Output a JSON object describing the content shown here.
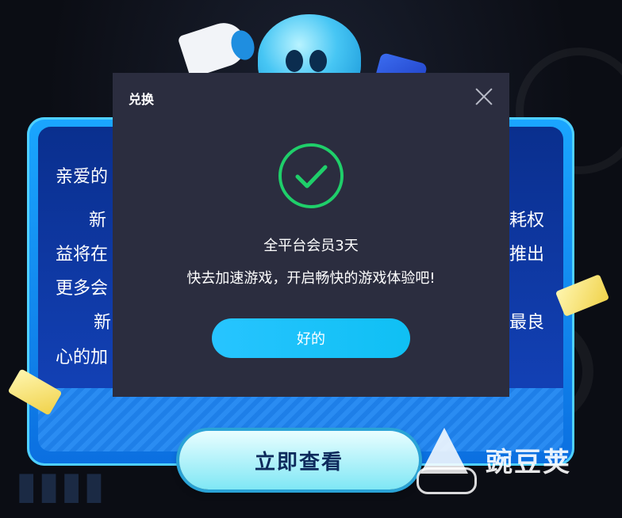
{
  "dialog": {
    "title": "兑换",
    "message_line1": "全平台会员3天",
    "message_line2": "快去加速游戏，开启畅快的游戏体验吧!",
    "ok_label": "好的",
    "close_icon": "close-icon",
    "success_icon": "check-circle-icon"
  },
  "background_card": {
    "line1": "亲爱的",
    "line2_left": "新",
    "line2_right": "耗权",
    "line3_left": "益将在",
    "line3_right": "推出",
    "line4_left": "更多会",
    "line5_left": "新",
    "line5_right": "最良",
    "line6_left": "心的加",
    "cta_label": "立即查看"
  },
  "watermark": {
    "text": "豌豆荚"
  },
  "colors": {
    "dialog_bg": "#2b2d3f",
    "success_green": "#1fcf6a",
    "button_cyan": "#1ec3f8",
    "card_blue": "#0b6fe0"
  }
}
